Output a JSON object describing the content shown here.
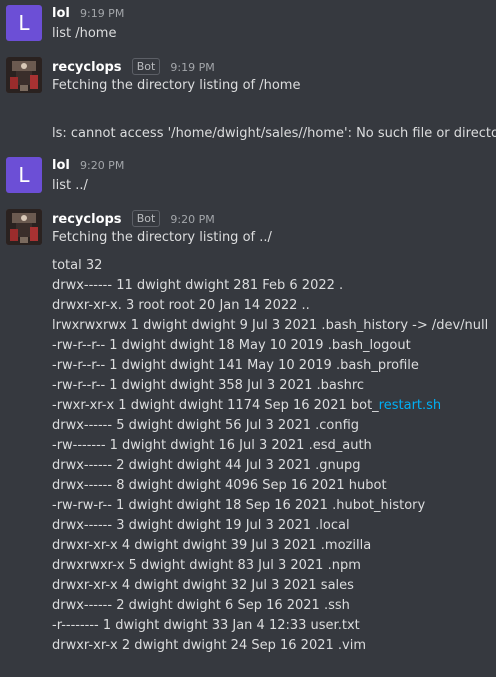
{
  "messages": [
    {
      "author": "lol",
      "avatar_letter": "L",
      "time": "9:19 PM",
      "lines": [
        "list /home"
      ]
    },
    {
      "author": "recyclops",
      "bot_tag": "Bot",
      "time": "9:19 PM",
      "lines": [
        "Fetching the directory listing of /home",
        "ls: cannot access '/home/dwight/sales//home': No such file or directory"
      ]
    },
    {
      "author": "lol",
      "avatar_letter": "L",
      "time": "9:20 PM",
      "lines": [
        "list ../"
      ]
    },
    {
      "author": "recyclops",
      "bot_tag": "Bot",
      "time": "9:20 PM",
      "intro": "Fetching the directory listing of ../",
      "listing": [
        "total 32",
        "drwx------ 11 dwight dwight 281 Feb 6 2022 .",
        "drwxr-xr-x. 3 root root 20 Jan 14 2022 ..",
        "lrwxrwxrwx 1 dwight dwight 9 Jul 3 2021 .bash_history -> /dev/null",
        "-rw-r--r-- 1 dwight dwight 18 May 10 2019 .bash_logout",
        "-rw-r--r-- 1 dwight dwight 141 May 10 2019 .bash_profile",
        "-rw-r--r-- 1 dwight dwight 358 Jul 3 2021 .bashrc",
        "-rwxr-xr-x 1 dwight dwight 1174 Sep 16 2021 bot_",
        "drwx------ 5 dwight dwight 56 Jul 3 2021 .config",
        "-rw------- 1 dwight dwight 16 Jul 3 2021 .esd_auth",
        "drwx------ 2 dwight dwight 44 Jul 3 2021 .gnupg",
        "drwx------ 8 dwight dwight 4096 Sep 16 2021 hubot",
        "-rw-rw-r-- 1 dwight dwight 18 Sep 16 2021 .hubot_history",
        "drwx------ 3 dwight dwight 19 Jul 3 2021 .local",
        "drwxr-xr-x 4 dwight dwight 39 Jul 3 2021 .mozilla",
        "drwxrwxr-x 5 dwight dwight 83 Jul 3 2021 .npm",
        "drwxr-xr-x 4 dwight dwight 32 Jul 3 2021 sales",
        "drwx------ 2 dwight dwight 6 Sep 16 2021 .ssh",
        "-r-------- 1 dwight dwight 33 Jan 4 12:33 user.txt",
        "drwxr-xr-x 2 dwight dwight 24 Sep 16 2021 .vim"
      ],
      "link_text": "restart.sh"
    }
  ]
}
